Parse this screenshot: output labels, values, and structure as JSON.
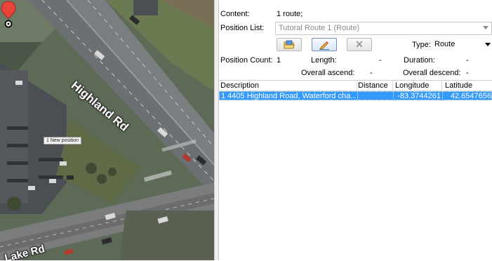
{
  "map": {
    "roads": {
      "main": "Highland Rd",
      "side": "Lake Rd"
    },
    "marker_label": "1 New position"
  },
  "panel": {
    "content_label": "Content:",
    "content_value": "1 route;",
    "position_list_label": "Position List:",
    "position_list_value": "Tutoral Route 1 (Route)",
    "toolbar": {
      "open_icon": "folder-open-icon",
      "edit_icon": "pencil-icon",
      "delete_icon": "x-icon",
      "delete_label": "✕"
    },
    "type_label": "Type:",
    "type_value": "Route",
    "position_count_label": "Position Count:",
    "position_count_value": "1",
    "length_label": "Length:",
    "length_value": "-",
    "duration_label": "Duration:",
    "duration_value": "-",
    "ascend_label": "Overall ascend:",
    "ascend_value": "-",
    "descend_label": "Overall descend:",
    "descend_value": "-"
  },
  "table": {
    "columns": [
      "Description",
      "Distance",
      "Longitude",
      "Latitude"
    ],
    "rows": [
      {
        "description": "1 4405 Highland Road, Waterford cha...",
        "distance": "",
        "longitude": "-83.3744261",
        "latitude": "42.6547656"
      }
    ]
  },
  "colors": {
    "selection": "#3399ff",
    "pin": "#e8443a"
  }
}
